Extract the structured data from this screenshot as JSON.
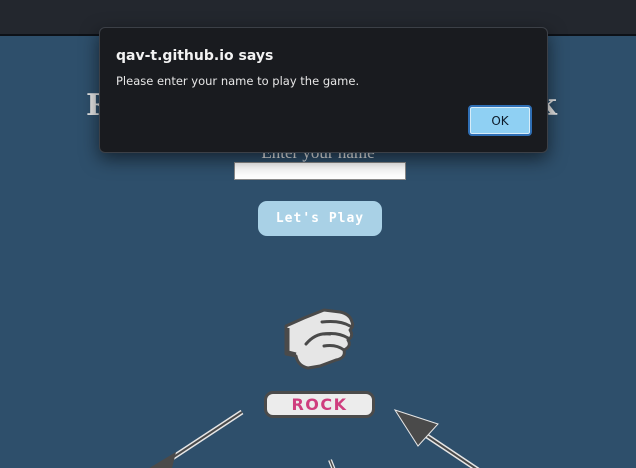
{
  "page": {
    "title_left": "R",
    "title_right": "k",
    "name_label": "Enter your name",
    "play_button": "Let's Play",
    "choice_label": "ROCK"
  },
  "dialog": {
    "title": "qav-t.github.io says",
    "message": "Please enter your name to play the game.",
    "ok_label": "OK"
  },
  "icons": {
    "fist": "rock-fist-icon",
    "arrows": "arrow-icon"
  },
  "colors": {
    "background": "#2e4f6b",
    "play_button": "#a9d1e6",
    "rock_text": "#cf3d7e",
    "dialog_bg": "#191b1f",
    "ok_button": "#8fd0f3"
  }
}
